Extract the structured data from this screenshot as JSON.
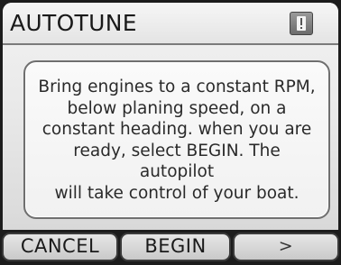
{
  "header": {
    "title": "AUTOTUNE",
    "alert_icon": "exclamation-icon"
  },
  "message": {
    "lines": [
      "Bring engines to a constant RPM,",
      "below planing speed, on a",
      "constant heading. when you are",
      "ready, select BEGIN. The autopilot",
      "will take control of your boat."
    ]
  },
  "softkeys": {
    "cancel_label": "CANCEL",
    "begin_label": "BEGIN",
    "next_label": ">"
  },
  "colors": {
    "panel_background": "#ececec",
    "softkey_bar": "#1c1c1c",
    "border": "#6f6f6f"
  }
}
